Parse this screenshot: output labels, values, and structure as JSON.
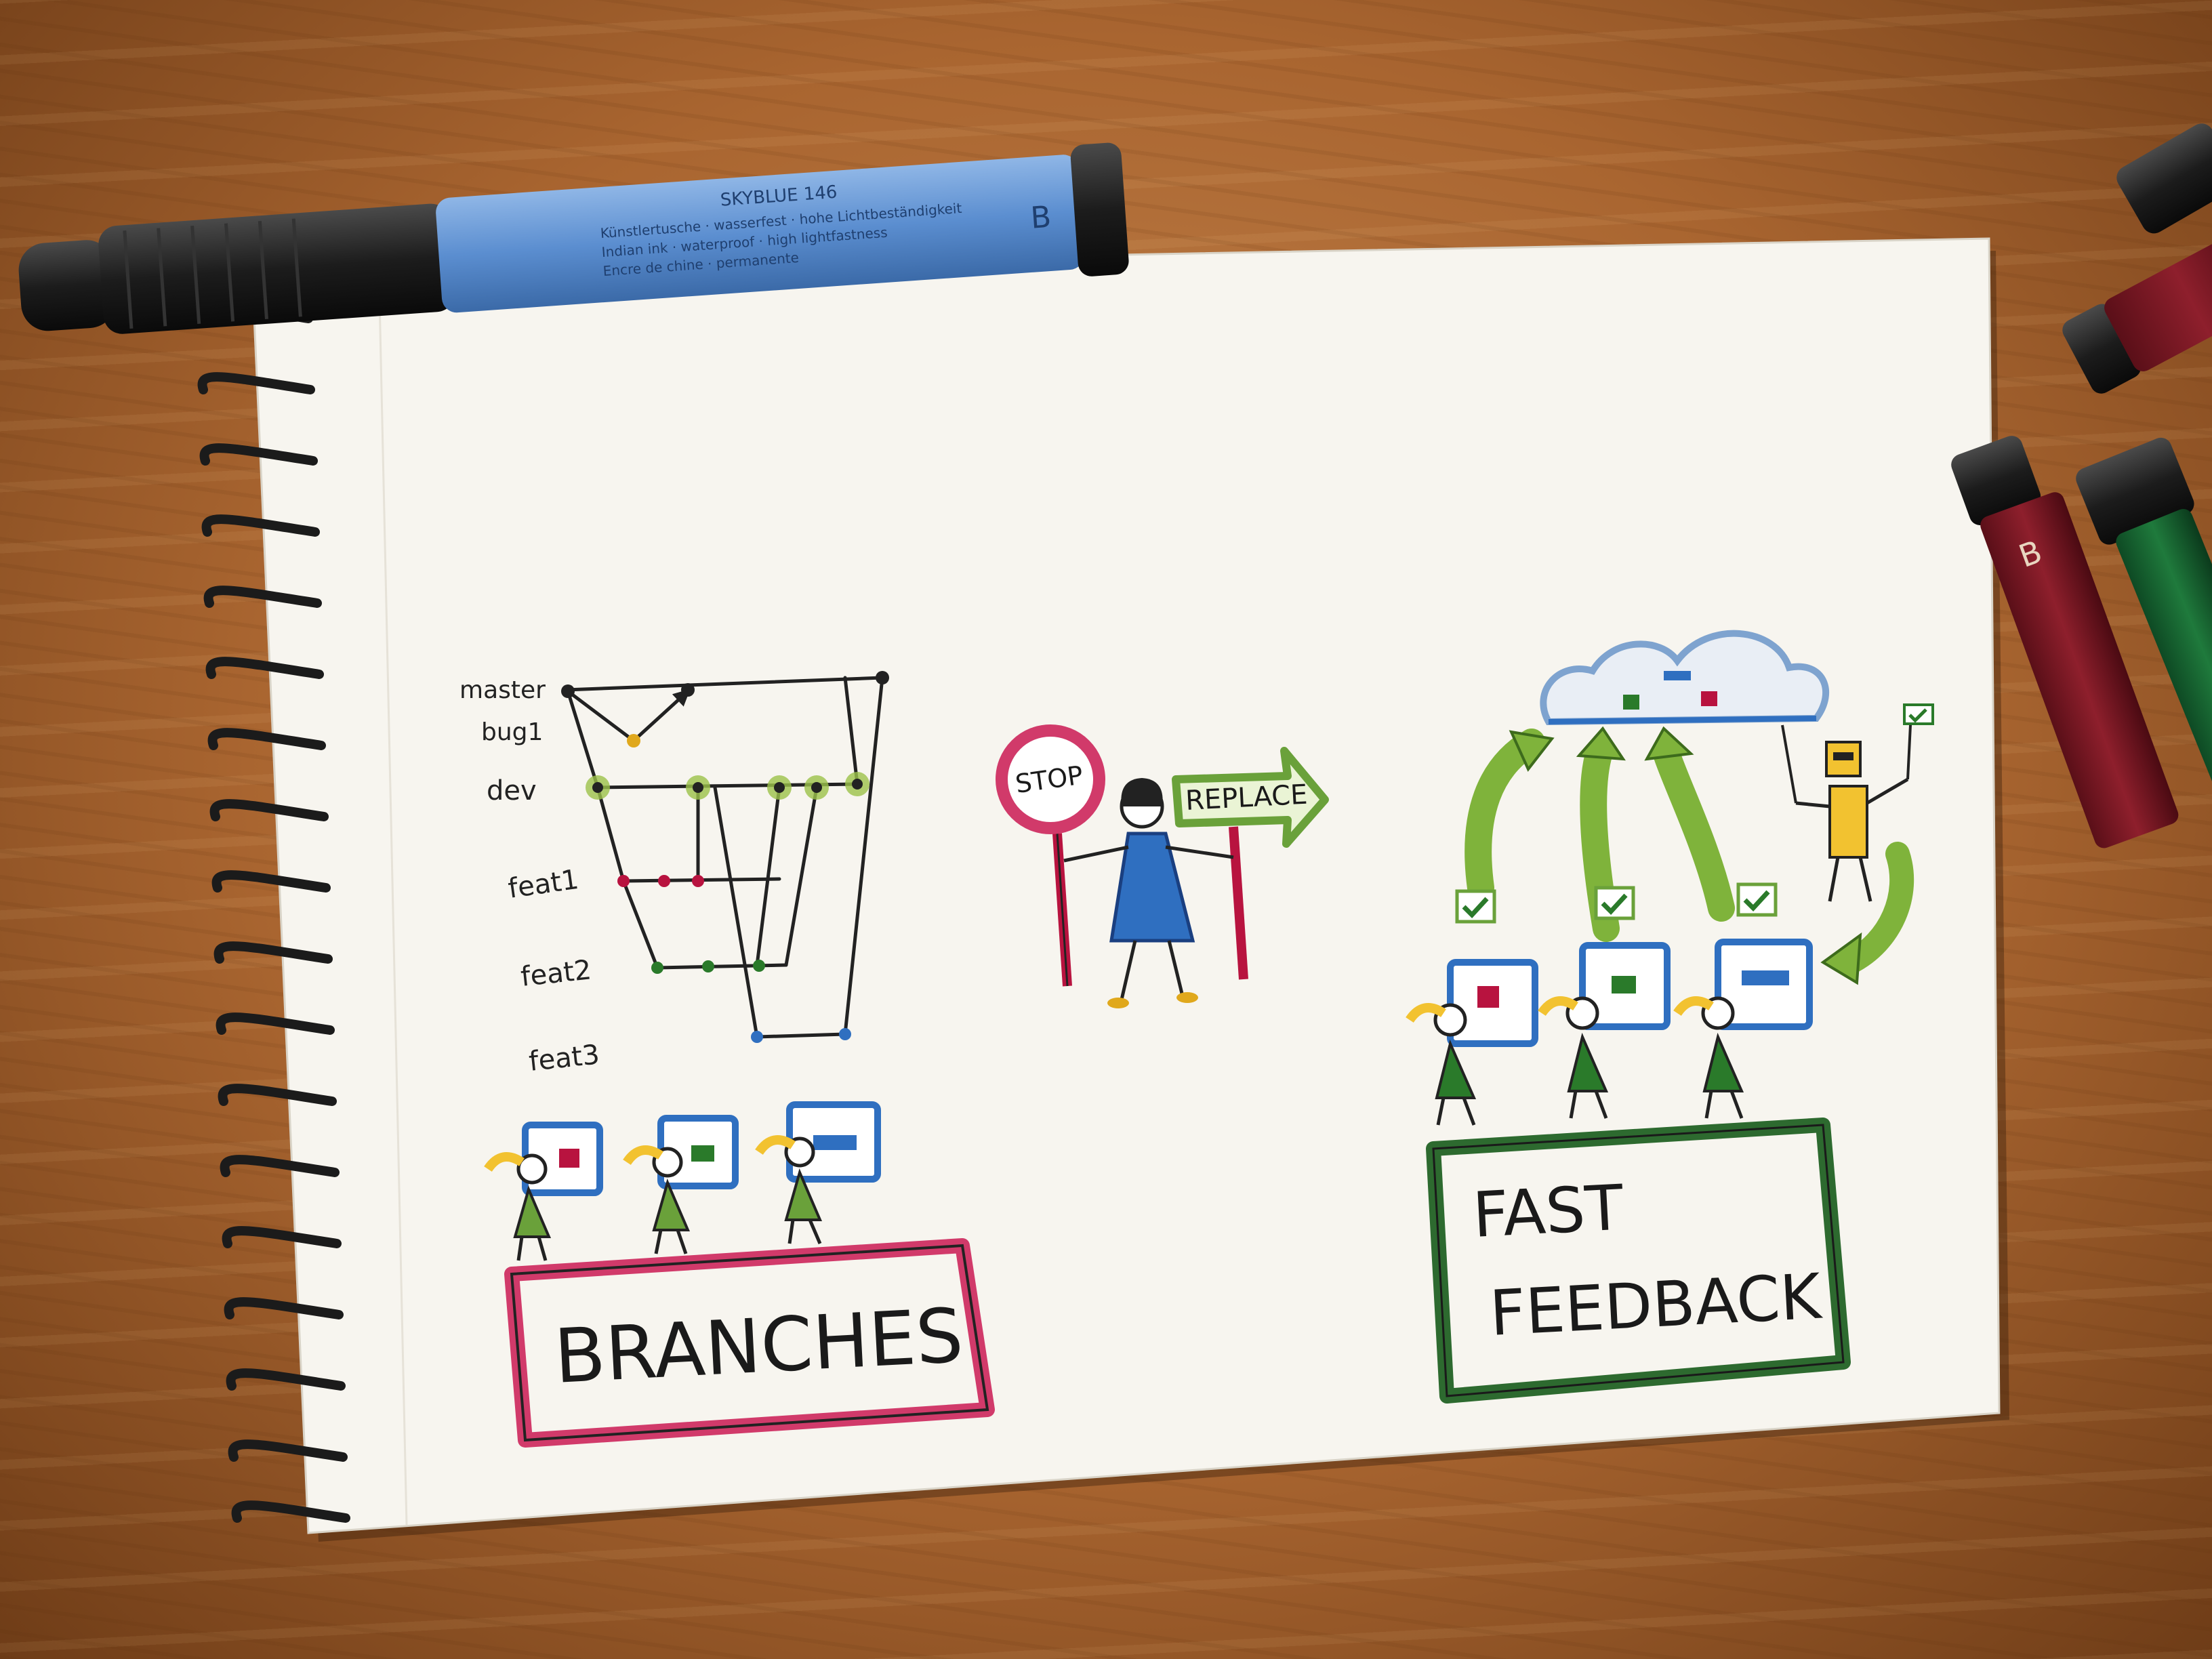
{
  "pen": {
    "brand_line": "SKYBLUE 146",
    "size_letter": "B",
    "label_line_1": "Künstlertusche · wasserfest · hohe Lichtbeständigkeit",
    "label_line_2": "Indian ink · waterproof · high lightfastness",
    "label_line_3": "Encre de chine · permanente"
  },
  "markers": {
    "size_letter": "B"
  },
  "branches_diagram": {
    "labels": [
      "master",
      "bug1",
      "dev",
      "feat1",
      "feat2",
      "feat3"
    ]
  },
  "stop_sign": {
    "text": "STOP"
  },
  "replace_arrow": {
    "text": "REPLACE"
  },
  "branches_box": {
    "title": "BRANCHES"
  },
  "fast_feedback_box": {
    "line_1": "FAST",
    "line_2": "FEEDBACK"
  },
  "colors": {
    "red_marker": "#b8133f",
    "green_marker": "#2d6a2f",
    "blue_ink": "#2f6fc0",
    "light_green": "#7fb33b",
    "yellow": "#f2c230",
    "paper": "#f7f5ef"
  },
  "icons": [
    "computer-icon",
    "person-icon",
    "cloud-icon",
    "robot-icon",
    "checkmark-icon",
    "arrow-icon"
  ]
}
